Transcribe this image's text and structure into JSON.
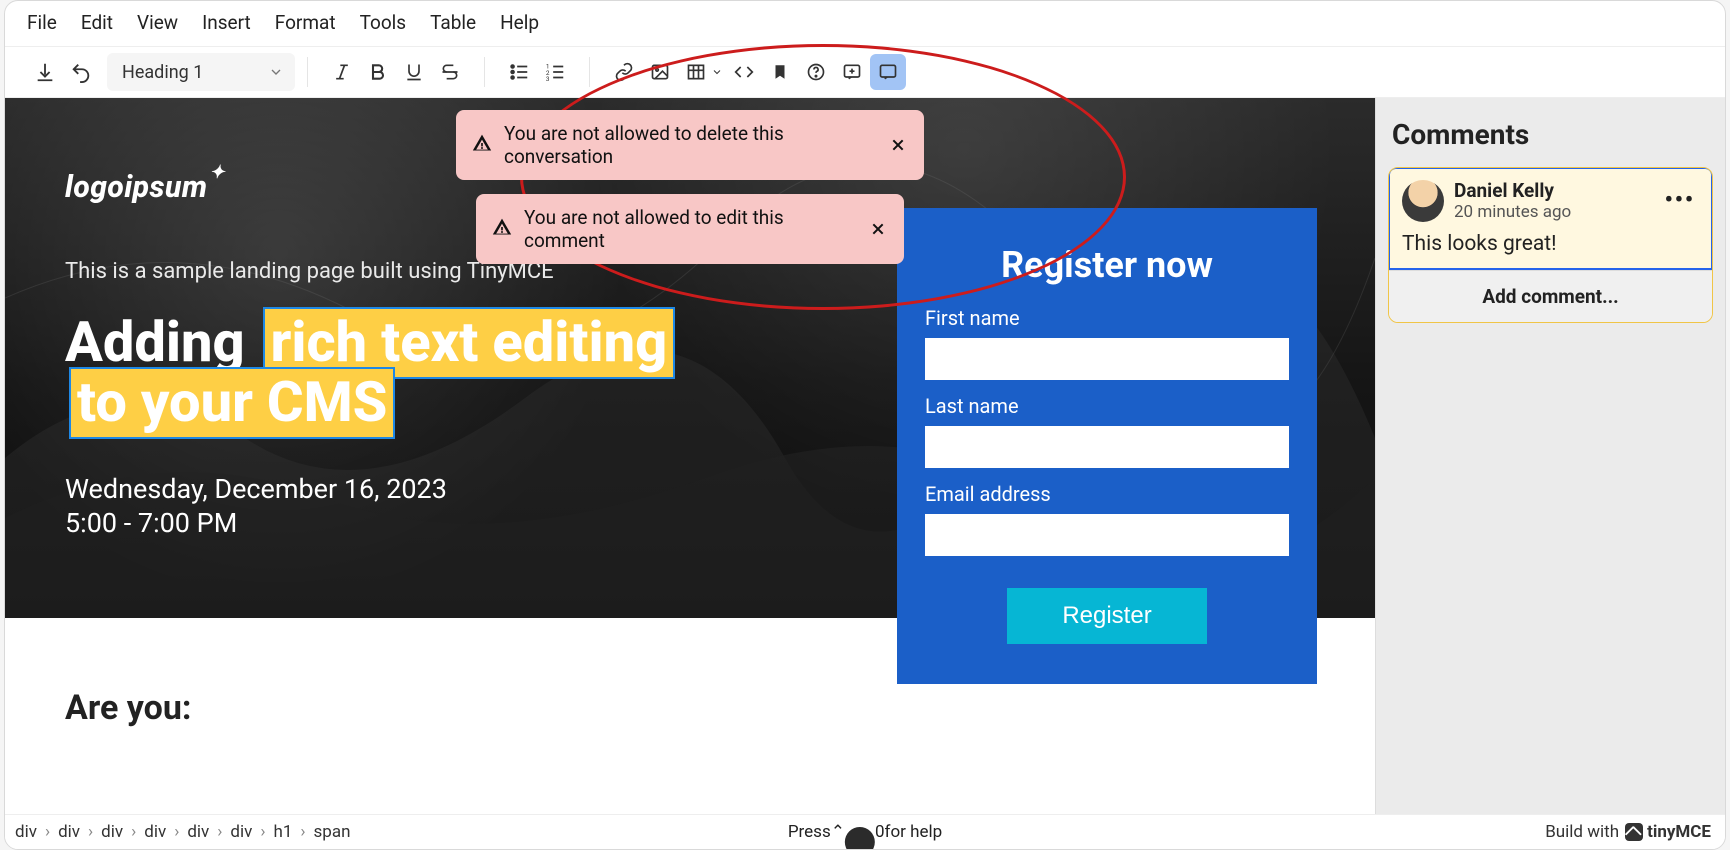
{
  "menubar": {
    "items": [
      "File",
      "Edit",
      "View",
      "Insert",
      "Format",
      "Tools",
      "Table",
      "Help"
    ]
  },
  "toolbar": {
    "blockFormat": "Heading 1"
  },
  "notifications": [
    {
      "text": "You are not allowed to delete this conversation"
    },
    {
      "text": "You are not allowed to edit this comment"
    }
  ],
  "hero": {
    "logo_text": "logoipsum",
    "logo_spark": "✦",
    "tagline": "This is a sample landing page built using TinyMCE",
    "h1_prefix": "Adding ",
    "h1_highlight": "rich text editing to your CMS",
    "date": "Wednesday, December 16, 2023",
    "time": "5:00 - 7:00 PM"
  },
  "register": {
    "title": "Register now",
    "fields": {
      "first": {
        "label": "First name",
        "value": ""
      },
      "last": {
        "label": "Last name",
        "value": ""
      },
      "email": {
        "label": "Email address",
        "value": ""
      }
    },
    "submit": "Register"
  },
  "below": {
    "heading": "Are you:"
  },
  "comments": {
    "panel_title": "Comments",
    "threads": [
      {
        "author": "Daniel Kelly",
        "time": "20 minutes ago",
        "text": "This looks great!"
      }
    ],
    "add_label": "Add comment..."
  },
  "statusbar": {
    "path": [
      "div",
      "div",
      "div",
      "div",
      "div",
      "div",
      "h1",
      "span"
    ],
    "help_prefix": "Press ",
    "help_combo_left": "⌃",
    "help_combo_right": "0",
    "help_suffix": " for help",
    "build_with": "Build with ",
    "brand": "tinyMCE"
  }
}
